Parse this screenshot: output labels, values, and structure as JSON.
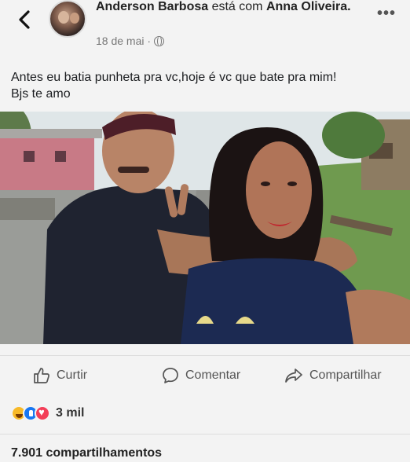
{
  "header": {
    "author_prefix": "Anderson Barbosa",
    "with_text": " está com ",
    "tagged": "Anna Oliveira.",
    "date": "18 de mai ·",
    "privacy_icon": "globe-icon",
    "back_icon": "chevron-left-icon",
    "more_icon": "more-options-icon",
    "more_label": "•••"
  },
  "post": {
    "line1": "Antes eu batia punheta pra vc,hoje  é vc que bate pra mim!",
    "line2": "Bjs te amo"
  },
  "actions": {
    "like": "Curtir",
    "comment": "Comentar",
    "share": "Compartilhar"
  },
  "reactions": {
    "icons": [
      "haha",
      "like",
      "love"
    ],
    "count": "3 mil"
  },
  "shares": {
    "label": "7.901 compartilhamentos"
  },
  "colors": {
    "like_blue": "#1877f2",
    "love_red": "#f33e58",
    "haha_yellow": "#f7b928",
    "text_gray": "#555555"
  }
}
